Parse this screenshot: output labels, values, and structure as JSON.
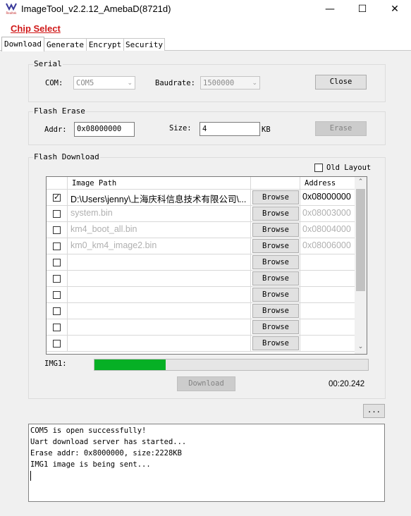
{
  "window": {
    "title": "ImageTool_v2.2.12_AmebaD(8721d)",
    "icon_text": "Realtek",
    "minimize": "—",
    "maximize": "☐",
    "close": "✕"
  },
  "chip_select": "Chip Select",
  "tabs": [
    {
      "label": "Download",
      "active": true
    },
    {
      "label": "Generate"
    },
    {
      "label": "Encrypt"
    },
    {
      "label": "Security"
    }
  ],
  "serial": {
    "group_title": "Serial",
    "com_label": "COM:",
    "com_value": "COM5",
    "baud_label": "Baudrate:",
    "baud_value": "1500000",
    "close_button": "Close"
  },
  "flash_erase": {
    "group_title": "Flash Erase",
    "addr_label": "Addr:",
    "addr_value": "0x08000000",
    "size_label": "Size:",
    "size_value": "4",
    "unit": "KB",
    "erase_button": "Erase"
  },
  "flash_download": {
    "group_title": "Flash Download",
    "old_layout_label": "Old Layout",
    "col_image_path": "Image Path",
    "col_address": "Address",
    "browse_label": "Browse",
    "rows": [
      {
        "checked": true,
        "path": "D:\\Users\\jenny\\上海庆科信息技术有限公司\\...",
        "address": "0x08000000",
        "dim": false
      },
      {
        "checked": false,
        "path": "system.bin",
        "address": "0x08003000",
        "dim": true
      },
      {
        "checked": false,
        "path": "km4_boot_all.bin",
        "address": "0x08004000",
        "dim": true
      },
      {
        "checked": false,
        "path": "km0_km4_image2.bin",
        "address": "0x08006000",
        "dim": true
      },
      {
        "checked": false,
        "path": "",
        "address": "",
        "dim": true
      },
      {
        "checked": false,
        "path": "",
        "address": "",
        "dim": true
      },
      {
        "checked": false,
        "path": "",
        "address": "",
        "dim": true
      },
      {
        "checked": false,
        "path": "",
        "address": "",
        "dim": true
      },
      {
        "checked": false,
        "path": "",
        "address": "",
        "dim": true
      },
      {
        "checked": false,
        "path": "",
        "address": "",
        "dim": true
      }
    ],
    "progress_label": "IMG1:",
    "progress_fraction": 0.26,
    "download_button": "Download",
    "elapsed": "00:20.242"
  },
  "more_button": "...",
  "log": [
    "COM5 is open successfully!",
    "Uart download server has started...",
    "Erase addr: 0x8000000, size:2228KB",
    "IMG1 image is being sent..."
  ],
  "colors": {
    "chip_select": "#d01818",
    "progress": "#06b025",
    "panel_bg": "#f0f0f0"
  }
}
